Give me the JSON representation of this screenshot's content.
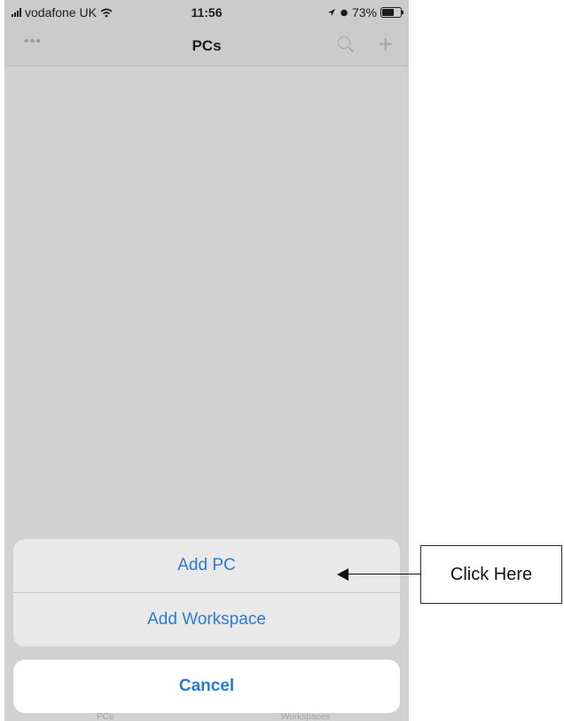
{
  "status_bar": {
    "carrier": "vodafone UK",
    "time": "11:56",
    "battery": "73%",
    "battery_level": 0.73
  },
  "nav": {
    "title": "PCs",
    "more_icon": "ellipsis-icon",
    "search_icon": "search-icon",
    "add_icon": "plus-icon"
  },
  "action_sheet": {
    "items": [
      {
        "label": "Add PC"
      },
      {
        "label": "Add Workspace"
      }
    ],
    "cancel_label": "Cancel"
  },
  "tab_bar": {
    "left_label": "PCs",
    "right_label": "Workspaces"
  },
  "annotation": {
    "text": "Click Here"
  },
  "colors": {
    "accent": "#2a7bd6",
    "dim_background": "#d1d1d1"
  }
}
